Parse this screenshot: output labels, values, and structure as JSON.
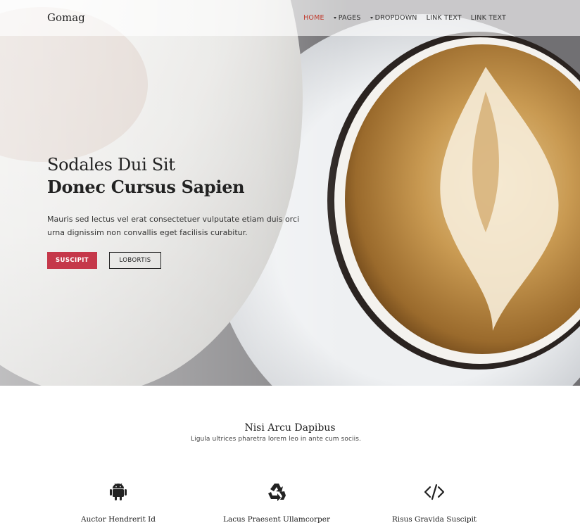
{
  "brand": "Gomag",
  "nav": [
    {
      "label": "HOME",
      "active": true,
      "dropdown": false
    },
    {
      "label": "PAGES",
      "active": false,
      "dropdown": true
    },
    {
      "label": "DROPDOWN",
      "active": false,
      "dropdown": true
    },
    {
      "label": "LINK TEXT",
      "active": false,
      "dropdown": false
    },
    {
      "label": "LINK TEXT",
      "active": false,
      "dropdown": false
    }
  ],
  "hero": {
    "title_light": "Sodales Dui Sit",
    "title_bold": "Donec Cursus Sapien",
    "description": "Mauris sed lectus vel erat consectetuer vulputate etiam duis orci urna dignissim non convallis eget facilisis curabitur.",
    "primary_button": "SUSCIPIT",
    "secondary_button": "LOBORTIS"
  },
  "features_section": {
    "title": "Nisi Arcu Dapibus",
    "subtitle": "Ligula ultrices pharetra lorem leo in ante cum sociis.",
    "items": [
      {
        "icon": "android-icon",
        "label": "Auctor Hendrerit Id"
      },
      {
        "icon": "recycle-icon",
        "label": "Lacus Praesent Ullamcorper"
      },
      {
        "icon": "code-icon",
        "label": "Risus Gravida Suscipit"
      }
    ]
  },
  "colors": {
    "accent": "#c5384a",
    "active_nav": "#c0392b",
    "text_dark": "#222222"
  }
}
